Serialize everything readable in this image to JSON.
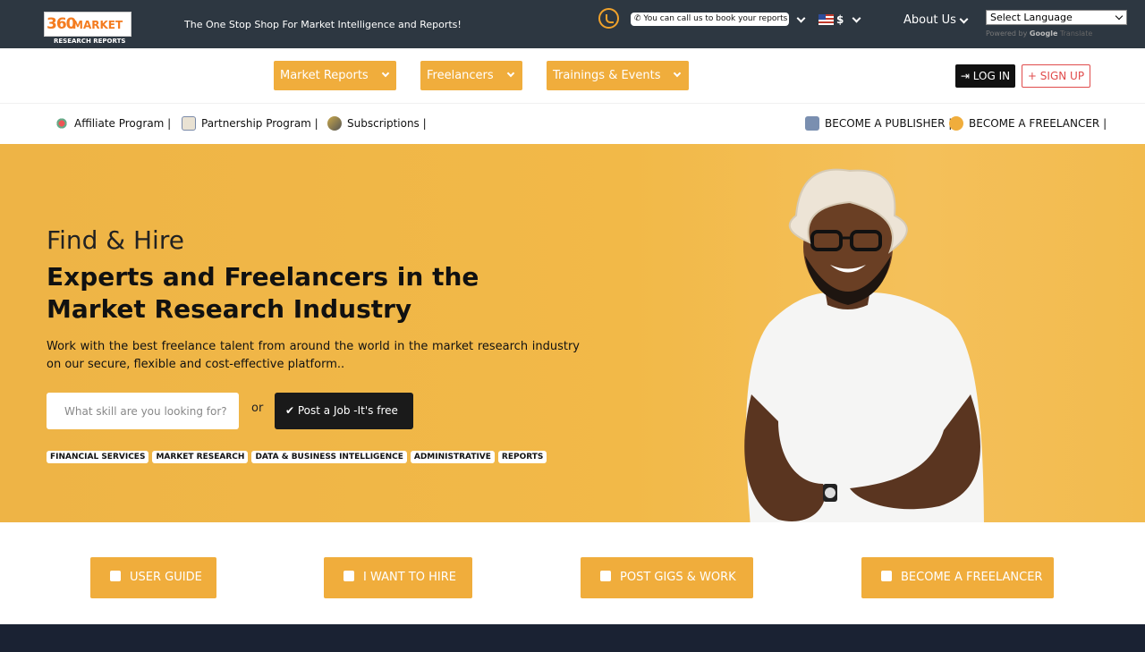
{
  "header": {
    "logo": {
      "number": "360",
      "word": "MARKET",
      "subtitle": "RESEARCH REPORTS"
    },
    "tagline": "The One Stop Shop For Market Intelligence and Reports!",
    "call_text": "You can call us to book your reports",
    "currency": "$",
    "about": "About Us",
    "language_select": "Select Language",
    "powered_by": "Powered by",
    "google": "Google",
    "translate": "Translate"
  },
  "nav": {
    "items": [
      {
        "label": "Market Reports"
      },
      {
        "label": "Freelancers"
      },
      {
        "label": "Trainings & Events"
      }
    ],
    "login": "LOG IN",
    "signup": "SIGN UP"
  },
  "subnav": {
    "left": [
      {
        "label": "Affiliate Program |"
      },
      {
        "label": "Partnership Program |"
      },
      {
        "label": "Subscriptions |"
      }
    ],
    "right": [
      {
        "label": "BECOME A PUBLISHER |"
      },
      {
        "label": "BECOME A FREELANCER |"
      }
    ]
  },
  "hero": {
    "kicker": "Find & Hire",
    "title": "Experts and Freelancers in the Market Research Industry",
    "description": "Work with the best freelance talent from around the world in the market research industry on our secure, flexible and cost-effective platform..",
    "search_placeholder": "What skill are you looking for?",
    "or": "or",
    "post_job": "Post a Job -It's free",
    "tags": [
      "FINANCIAL SERVICES",
      "MARKET RESEARCH",
      "DATA & BUSINESS INTELLIGENCE",
      "ADMINISTRATIVE",
      "REPORTS"
    ]
  },
  "actions": [
    {
      "label": "USER GUIDE",
      "icon": "book-icon"
    },
    {
      "label": "I WANT TO HIRE",
      "icon": "briefcase-icon"
    },
    {
      "label": "POST GIGS & WORK",
      "icon": "list-check-icon"
    },
    {
      "label": "BECOME A FREELANCER",
      "icon": "user-icon"
    }
  ],
  "colors": {
    "topbar": "#2d3741",
    "accent": "#f0ad3c",
    "hero_bg": "#f2b948",
    "logo_orange": "#f47c20",
    "signup_red": "#e04b4b",
    "footer": "#1a2233"
  }
}
